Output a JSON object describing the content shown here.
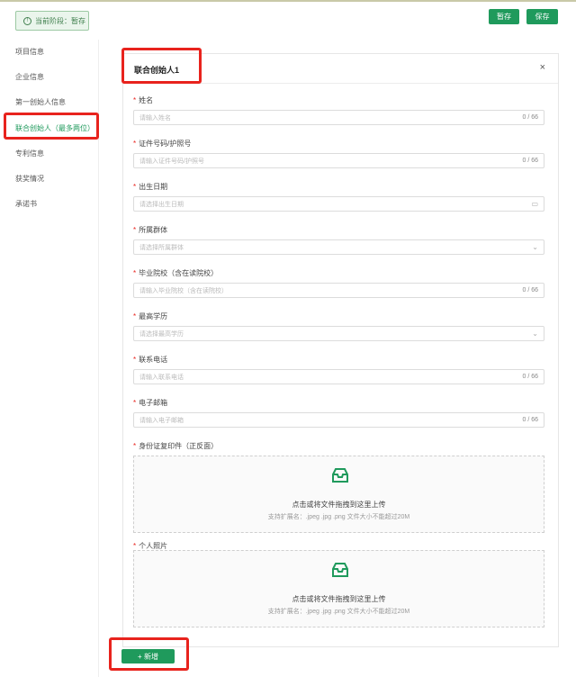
{
  "stage": {
    "label": "当前阶段：暂存",
    "icon": "info-icon"
  },
  "toolbar": {
    "stash_label": "暂存",
    "save_label": "保存"
  },
  "sidebar": {
    "items": [
      {
        "label": "项目信息"
      },
      {
        "label": "企业信息"
      },
      {
        "label": "第一创始人信息"
      },
      {
        "label": "联合创始人（最多两位）",
        "active": true
      },
      {
        "label": "专利信息"
      },
      {
        "label": "获奖情况"
      },
      {
        "label": "承诺书"
      }
    ]
  },
  "panel": {
    "title": "联合创始人1",
    "close_icon": "close-icon",
    "fields": [
      {
        "label": "姓名",
        "placeholder": "请输入姓名",
        "counter": "0 / 66"
      },
      {
        "label": "证件号码/护照号",
        "placeholder": "请输入证件号码/护照号",
        "counter": "0 / 66"
      },
      {
        "label": "出生日期",
        "placeholder": "请选择出生日期",
        "icon": "calendar-icon"
      },
      {
        "label": "所属群体",
        "placeholder": "请选择所属群体",
        "icon": "chevron-down-icon"
      },
      {
        "label": "毕业院校（含在读院校）",
        "placeholder": "请输入毕业院校（含在读院校）",
        "counter": "0 / 66"
      },
      {
        "label": "最高学历",
        "placeholder": "请选择最高学历",
        "icon": "chevron-down-icon"
      },
      {
        "label": "联系电话",
        "placeholder": "请输入联系电话",
        "counter": "0 / 66"
      },
      {
        "label": "电子邮箱",
        "placeholder": "请输入电子邮箱",
        "counter": "0 / 66"
      }
    ],
    "uploads": [
      {
        "label": "身份证复印件（正反面）",
        "main": "点击或将文件拖拽到这里上传",
        "sub": "支持扩展名：.jpeg .jpg .png 文件大小不能超过20M"
      },
      {
        "label": "个人照片",
        "main": "点击或将文件拖拽到这里上传",
        "sub": "支持扩展名：.jpeg .jpg .png 文件大小不能超过20M"
      }
    ]
  },
  "add_button": {
    "label": "+ 新增"
  },
  "colors": {
    "accent": "#1f9a5c",
    "highlight": "#e8231d",
    "required": "#e8231d"
  }
}
